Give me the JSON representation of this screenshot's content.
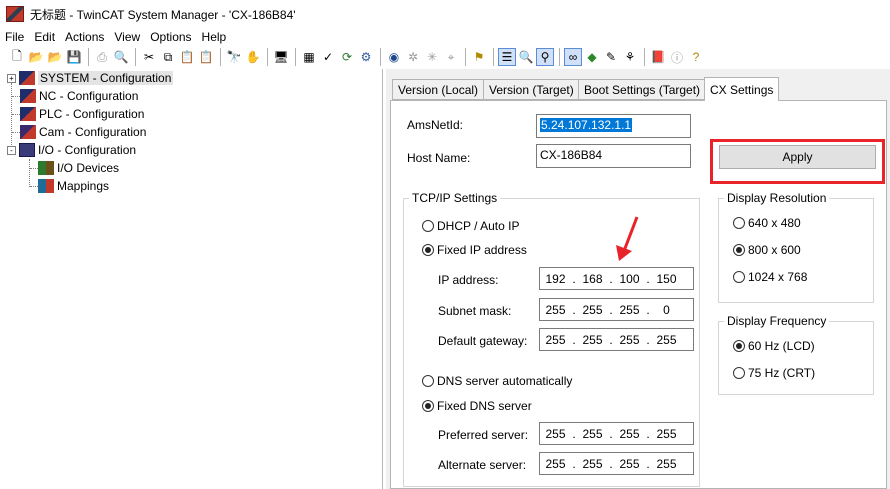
{
  "window": {
    "title": "无标题 - TwinCAT System Manager - 'CX-186B84'"
  },
  "menu": {
    "items": [
      "File",
      "Edit",
      "Actions",
      "View",
      "Options",
      "Help"
    ]
  },
  "toolbar": {
    "buttons": [
      "new-file-icon",
      "open-folder-icon",
      "open-icon",
      "save-icon",
      "print-icon",
      "print-preview-icon",
      "cut-icon",
      "copy-icon",
      "paste-icon",
      "paste-special-icon",
      "find-icon",
      "hand-icon",
      "target-icon",
      "activate-icon",
      "check-icon",
      "restart-icon",
      "config-icon",
      "network-icon",
      "settings-icon",
      "tools-icon",
      "scan-icon",
      "bookmark-icon",
      "zoom-icon",
      "debug-icon",
      "glasses-icon",
      "run-icon",
      "stop-icon",
      "help-book-icon",
      "info-icon",
      "help-icon"
    ]
  },
  "tree": {
    "items": [
      {
        "label": "SYSTEM - Configuration",
        "expander": "+",
        "icon": "system-config-icon",
        "selected": true
      },
      {
        "label": "NC - Configuration",
        "icon": "nc-config-icon"
      },
      {
        "label": "PLC - Configuration",
        "icon": "plc-config-icon"
      },
      {
        "label": "Cam - Configuration",
        "icon": "cam-config-icon"
      },
      {
        "label": "I/O - Configuration",
        "expander": "-",
        "icon": "io-config-icon"
      },
      {
        "label": "I/O Devices",
        "icon": "io-devices-icon"
      },
      {
        "label": "Mappings",
        "icon": "mappings-icon"
      }
    ]
  },
  "tabs": [
    {
      "label": "Version (Local)"
    },
    {
      "label": "Version (Target)"
    },
    {
      "label": "Boot Settings (Target)"
    },
    {
      "label": "CX Settings",
      "active": true
    }
  ],
  "cx": {
    "ams_label": "AmsNetId:",
    "ams_value": "5.24.107.132.1.1",
    "host_label": "Host Name:",
    "host_value": "CX-186B84",
    "apply_label": "Apply",
    "tcpip": {
      "title": "TCP/IP Settings",
      "dhcp_label": "DHCP / Auto IP",
      "fixed_ip_label": "Fixed IP address",
      "ip_label": "IP address:",
      "ip": [
        "192",
        "168",
        "100",
        "150"
      ],
      "subnet_label": "Subnet mask:",
      "subnet": [
        "255",
        "255",
        "255",
        "0"
      ],
      "gateway_label": "Default gateway:",
      "gateway": [
        "255",
        "255",
        "255",
        "255"
      ],
      "dns_auto_label": "DNS server automatically",
      "dns_fixed_label": "Fixed DNS server",
      "pref_label": "Preferred server:",
      "pref": [
        "255",
        "255",
        "255",
        "255"
      ],
      "alt_label": "Alternate server:",
      "alt": [
        "255",
        "255",
        "255",
        "255"
      ]
    },
    "resolution": {
      "title": "Display Resolution",
      "options": [
        "640 x 480",
        "800 x 600",
        "1024 x 768"
      ],
      "selected": "800 x 600"
    },
    "frequency": {
      "title": "Display Frequency",
      "options": [
        "60 Hz (LCD)",
        "75 Hz (CRT)"
      ],
      "selected": "60 Hz (LCD)"
    }
  },
  "colors": {
    "highlight": "#e8232a",
    "selection": "#0078d7"
  }
}
